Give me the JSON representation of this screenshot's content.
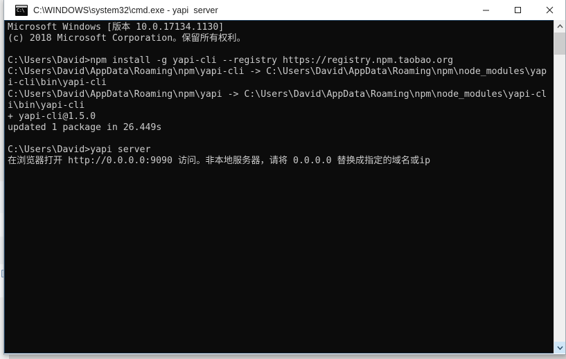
{
  "window": {
    "title": "C:\\WINDOWS\\system32\\cmd.exe - yapi  server",
    "icon": "cmd-icon",
    "icon_text": "C:\\",
    "controls": {
      "minimize_label": "Minimize",
      "maximize_label": "Maximize",
      "close_label": "Close"
    }
  },
  "console": {
    "background_color": "#0c0c0c",
    "text_color": "#cccccc",
    "lines": [
      "Microsoft Windows [版本 10.0.17134.1130]",
      "(c) 2018 Microsoft Corporation。保留所有权利。",
      "",
      "C:\\Users\\David>npm install -g yapi-cli --registry https://registry.npm.taobao.org",
      "C:\\Users\\David\\AppData\\Roaming\\npm\\yapi-cli -> C:\\Users\\David\\AppData\\Roaming\\npm\\node_modules\\yap",
      "i-cli\\bin\\yapi-cli",
      "C:\\Users\\David\\AppData\\Roaming\\npm\\yapi -> C:\\Users\\David\\AppData\\Roaming\\npm\\node_modules\\yapi-cl",
      "i\\bin\\yapi-cli",
      "+ yapi-cli@1.5.0",
      "updated 1 package in 26.449s",
      "",
      "C:\\Users\\David>yapi server",
      "在浏览器打开 http://0.0.0.0:9090 访问。非本地服务器，请将 0.0.0.0 替换成指定的域名或ip"
    ]
  },
  "scrollbar": {
    "up_arrow": "chevron-up-icon",
    "down_arrow": "chevron-down-icon",
    "thumb_label": "scroll-thumb"
  }
}
